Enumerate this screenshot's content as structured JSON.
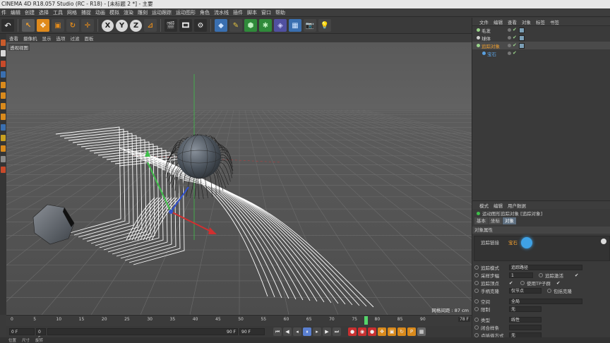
{
  "app": {
    "title": "CINEMA 4D R18.057 Studio (RC - R18) - [未标题 2 *] - 主要"
  },
  "menu": [
    "件",
    "编辑",
    "创建",
    "选择",
    "工具",
    "网格",
    "捕捉",
    "动画",
    "模拟",
    "渲染",
    "雕刻",
    "运动跟踪",
    "运动图形",
    "角色",
    "流水线",
    "插件",
    "脚本",
    "窗口",
    "帮助"
  ],
  "toolbar": {
    "axis_x": "X",
    "axis_y": "Y",
    "axis_z": "Z"
  },
  "viewport": {
    "menu": [
      "查看",
      "摄像机",
      "显示",
      "选项",
      "过滤",
      "面板"
    ],
    "label": "透视视图",
    "grid_readout": "网格间距 : 87 cm"
  },
  "object_manager": {
    "menu": [
      "文件",
      "编辑",
      "查看",
      "对象",
      "标签",
      "书签"
    ],
    "objects": [
      {
        "name": "毛发",
        "color": "#9ad38a"
      },
      {
        "name": "球体",
        "color": "#cfcfcf"
      },
      {
        "name": "追踪对象",
        "color": "#9ad38a"
      },
      {
        "name": "宝石",
        "color": "#5aa0e0"
      }
    ]
  },
  "attribute_manager": {
    "menu": [
      "模式",
      "编辑",
      "用户数据"
    ],
    "title": "运动图形追踪对象 [追踪对象]",
    "tabs": [
      "基本",
      "坐标",
      "对象"
    ],
    "active_tab": "对象",
    "section": "对象属性",
    "link_label": "追踪链接",
    "link_value": "宝石",
    "rows": [
      {
        "label": "追踪模式",
        "value": "追踪路径"
      },
      {
        "label": "采样步幅",
        "value": "1",
        "extra_label": "追踪激活"
      },
      {
        "label": "追踪顶点",
        "value": "✔",
        "extra_label": "使用TP子群"
      },
      {
        "label": "手柄克隆",
        "value": "仅节点",
        "extra_label": "包括克隆"
      },
      {
        "label": "空间",
        "value": "全局"
      },
      {
        "label": "限制",
        "value": "无"
      },
      {
        "label": "类型",
        "value": "线性"
      },
      {
        "label": "闭合样条",
        "value": ""
      },
      {
        "label": "点插值方式",
        "value": "无"
      }
    ]
  },
  "timeline": {
    "ticks": [
      "0",
      "5",
      "10",
      "15",
      "20",
      "25",
      "30",
      "35",
      "40",
      "45",
      "50",
      "55",
      "60",
      "65",
      "70",
      "75",
      "80",
      "85",
      "90"
    ],
    "current_frame": 78,
    "frame_end_readout": "78 F"
  },
  "transport": {
    "start": "0 F",
    "current": "0 F",
    "range_end": "90 F",
    "end": "90 F"
  },
  "bottom": [
    "位置",
    "尺寸",
    "旋转"
  ]
}
